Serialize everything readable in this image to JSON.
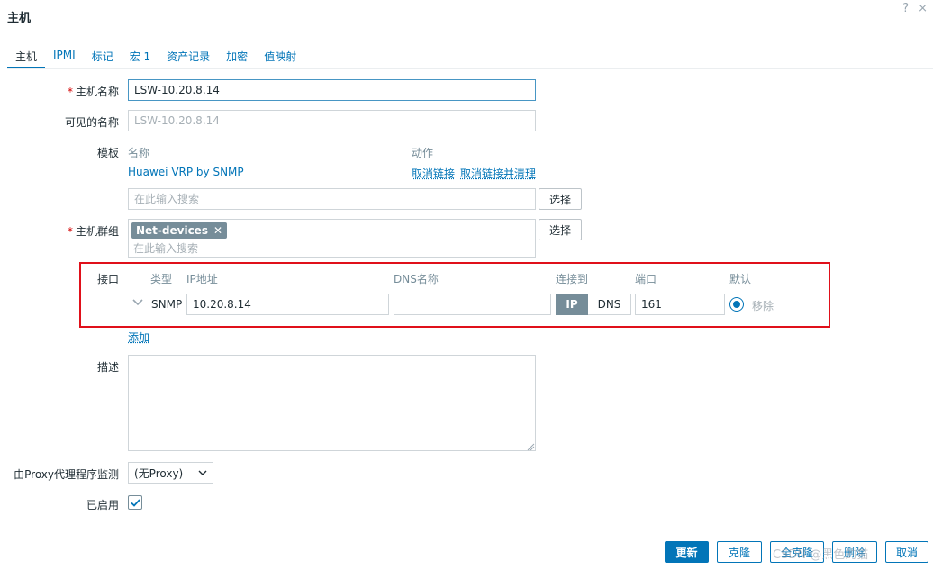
{
  "dialog": {
    "title": "主机",
    "help_icon": "?",
    "close_icon": "×"
  },
  "tabs": [
    {
      "label": "主机"
    },
    {
      "label": "IPMI"
    },
    {
      "label": "标记"
    },
    {
      "label": "宏 1"
    },
    {
      "label": "资产记录"
    },
    {
      "label": "加密"
    },
    {
      "label": "值映射"
    }
  ],
  "host_name": {
    "label": "主机名称",
    "required_mark": "*",
    "value": "LSW-10.20.8.14"
  },
  "visible_name": {
    "label": "可见的名称",
    "placeholder": "LSW-10.20.8.14"
  },
  "templates": {
    "label": "模板",
    "col_name": "名称",
    "col_action": "动作",
    "items": [
      {
        "name": "Huawei VRP by SNMP",
        "unlink": "取消链接",
        "unlink_clear": "取消链接并清理"
      }
    ],
    "search_placeholder": "在此输入搜索",
    "select_label": "选择"
  },
  "host_groups": {
    "label": "主机群组",
    "required_mark": "*",
    "tags": [
      {
        "name": "Net-devices",
        "remove_icon": "✕"
      }
    ],
    "search_placeholder": "在此输入搜索",
    "select_label": "选择"
  },
  "interfaces": {
    "label": "接口",
    "cols": {
      "type": "类型",
      "ip": "IP地址",
      "dns": "DNS名称",
      "connect": "连接到",
      "port": "端口",
      "default": "默认"
    },
    "rows": [
      {
        "type": "SNMP",
        "ip": "10.20.8.14",
        "dns": "",
        "connect_ip": "IP",
        "connect_dns": "DNS",
        "port": "161",
        "remove": "移除"
      }
    ],
    "add_label": "添加"
  },
  "description": {
    "label": "描述",
    "value": ""
  },
  "proxy": {
    "label": "由Proxy代理程序监测",
    "value": "(无Proxy)"
  },
  "enabled": {
    "label": "已启用",
    "checked": true
  },
  "footer": {
    "update": "更新",
    "clone": "克隆",
    "full_clone": "全克隆",
    "delete": "删除",
    "cancel": "取消"
  },
  "watermark": "CSDN @黑色的猫",
  "colors": {
    "accent": "#0275b8",
    "required": "#d40000",
    "highlight_box": "#e0101a",
    "tag_bg": "#768d99"
  }
}
